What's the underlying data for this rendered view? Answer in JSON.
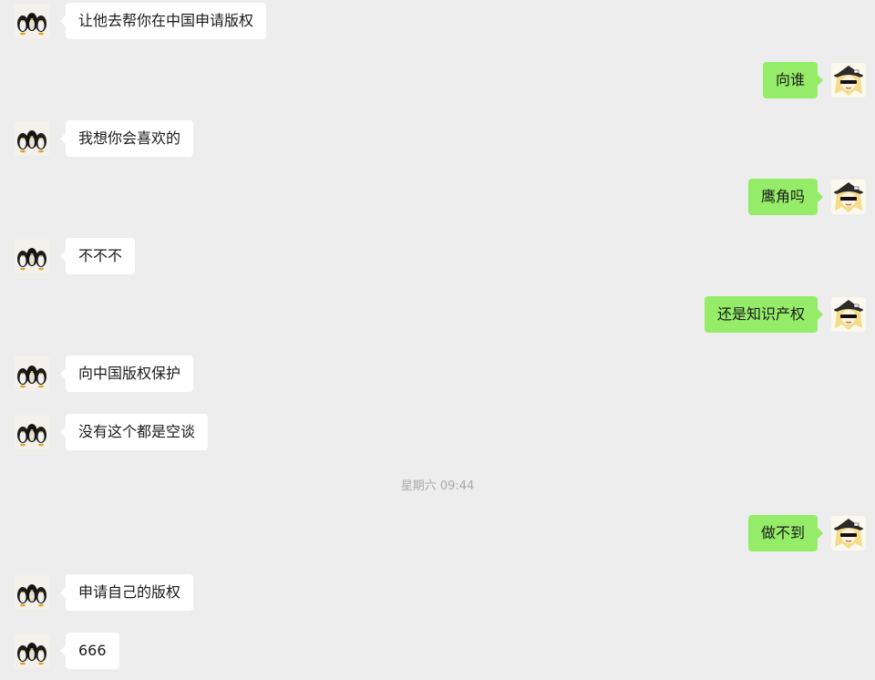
{
  "messages": [
    {
      "side": "left",
      "text": "让他去帮你在中国申请版权"
    },
    {
      "side": "right",
      "text": "向谁"
    },
    {
      "side": "left",
      "text": "我想你会喜欢的"
    },
    {
      "side": "right",
      "text": "鹰角吗"
    },
    {
      "side": "left",
      "text": "不不不"
    },
    {
      "side": "right",
      "text": "还是知识产权"
    },
    {
      "side": "left",
      "text": "向中国版权保护"
    },
    {
      "side": "left",
      "text": "没有这个都是空谈"
    },
    {
      "side": "right",
      "text": "做不到"
    },
    {
      "side": "left",
      "text": "申请自己的版权"
    },
    {
      "side": "left",
      "text": "666"
    }
  ],
  "timestamp": "星期六 09:44",
  "colors": {
    "background": "#ededed",
    "incoming_bubble": "#ffffff",
    "outgoing_bubble": "#95ec69",
    "timestamp_text": "#a9a9a9"
  },
  "icons": {
    "incoming_avatar": "penguin-group-avatar-icon",
    "outgoing_avatar": "blonde-witch-sunglasses-avatar-icon"
  }
}
